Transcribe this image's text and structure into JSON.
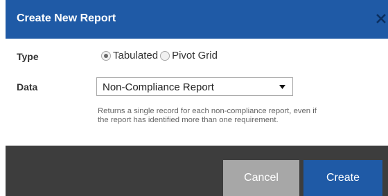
{
  "dialog": {
    "title": "Create New Report",
    "close_icon": "close-icon"
  },
  "form": {
    "type_label": "Type",
    "type_options": [
      {
        "label": "Tabulated",
        "selected": true
      },
      {
        "label": "Pivot Grid",
        "selected": false
      }
    ],
    "data_label": "Data",
    "data_select": {
      "value": "Non-Compliance Report",
      "arrow_icon": "dropdown-arrow-icon"
    },
    "help_text": [
      "Returns a single record for each non-compliance report, even if",
      "the report has identified more than one requirement."
    ]
  },
  "footer": {
    "cancel_label": "Cancel",
    "create_label": "Create"
  },
  "colors": {
    "header": "#1f5aa6",
    "footer": "#3d3d3d",
    "primary_button": "#1f5aa6",
    "secondary_button": "#a7a7a7"
  }
}
